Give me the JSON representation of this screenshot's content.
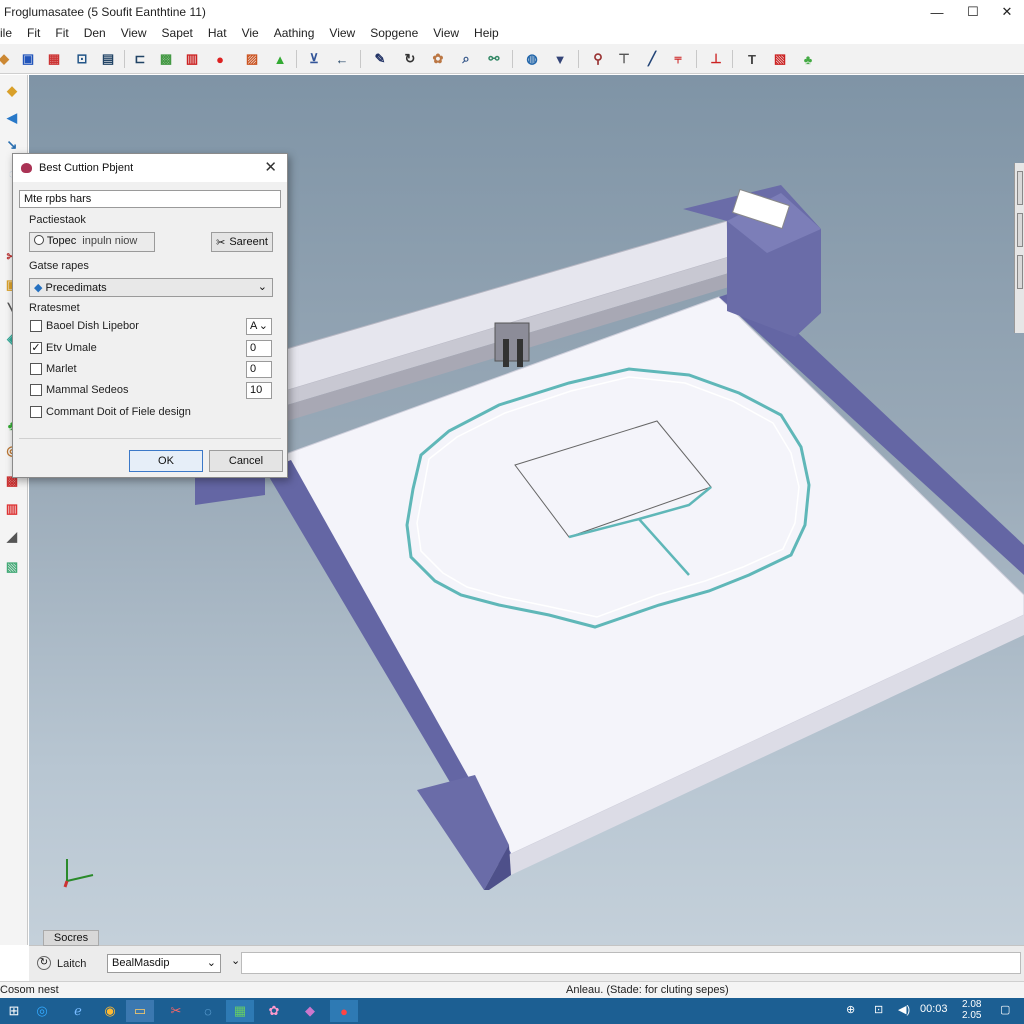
{
  "window": {
    "title": "Froglumasatee (5 Soufit Eanthtine 11)",
    "minimize": "—",
    "maximize": "☐",
    "close": "✕"
  },
  "menu": [
    "ile",
    "Fit",
    "Fit",
    "Den",
    "View",
    "Sapet",
    "Hat",
    "Vie",
    "Aathing",
    "View",
    "Sopgene",
    "View",
    "Heip"
  ],
  "toolbar_icons": [
    "save-icon",
    "page-icon",
    "grid-icon",
    "move-icon",
    "layer-icon",
    "red-dot-icon",
    "arrow-up-icon",
    "cart-icon",
    "arrow-left-icon",
    "pen-icon",
    "hook-icon",
    "nodes-icon",
    "zoom-icon",
    "link-icon",
    "globe-icon",
    "badge-icon",
    "pin-icon",
    "tee-icon",
    "blade-icon",
    "cutter-icon",
    "cutter-red-icon",
    "tee2-icon",
    "grid-red-icon",
    "tree-icon"
  ],
  "dialog": {
    "title": "Best Cuttion Pbjent",
    "close": "✕",
    "name_value": "Mte rpbs hars",
    "group1_label": "Pactiestaok",
    "radio_label": "Topec",
    "input_placeholder": "inpuln niow",
    "select_button": "Sareent",
    "group2_label": "Gatse rapes",
    "dropdown_value": "Precedimats",
    "group3_label": "Rratesmet",
    "options": [
      {
        "label": "Baoel Dish Lipebor",
        "checked": false,
        "value": "A"
      },
      {
        "label": "Etv Umale",
        "checked": true,
        "value": "0"
      },
      {
        "label": "Marlet",
        "checked": false,
        "value": "0"
      },
      {
        "label": "Mammal Sedeos",
        "checked": false,
        "value": "10"
      },
      {
        "label": "Commant Doit of Fiele design",
        "checked": false,
        "value": ""
      }
    ],
    "ok": "OK",
    "cancel": "Cancel"
  },
  "bottom": {
    "tab_label": "Socres",
    "mode_label": "Laitch",
    "dropdown_value": "BealMasdip"
  },
  "status": {
    "left": "Cosom nest",
    "right": "Anleau. (Stade: for cluting sepes)"
  },
  "taskbar": {
    "start": "⊞",
    "clock_time": "00:03",
    "clock_date": "2.08 2.05"
  },
  "colors": {
    "machine_purple": "#6a6ca8",
    "cut_path": "#5fb7b8",
    "taskbar": "#1c5f93"
  }
}
